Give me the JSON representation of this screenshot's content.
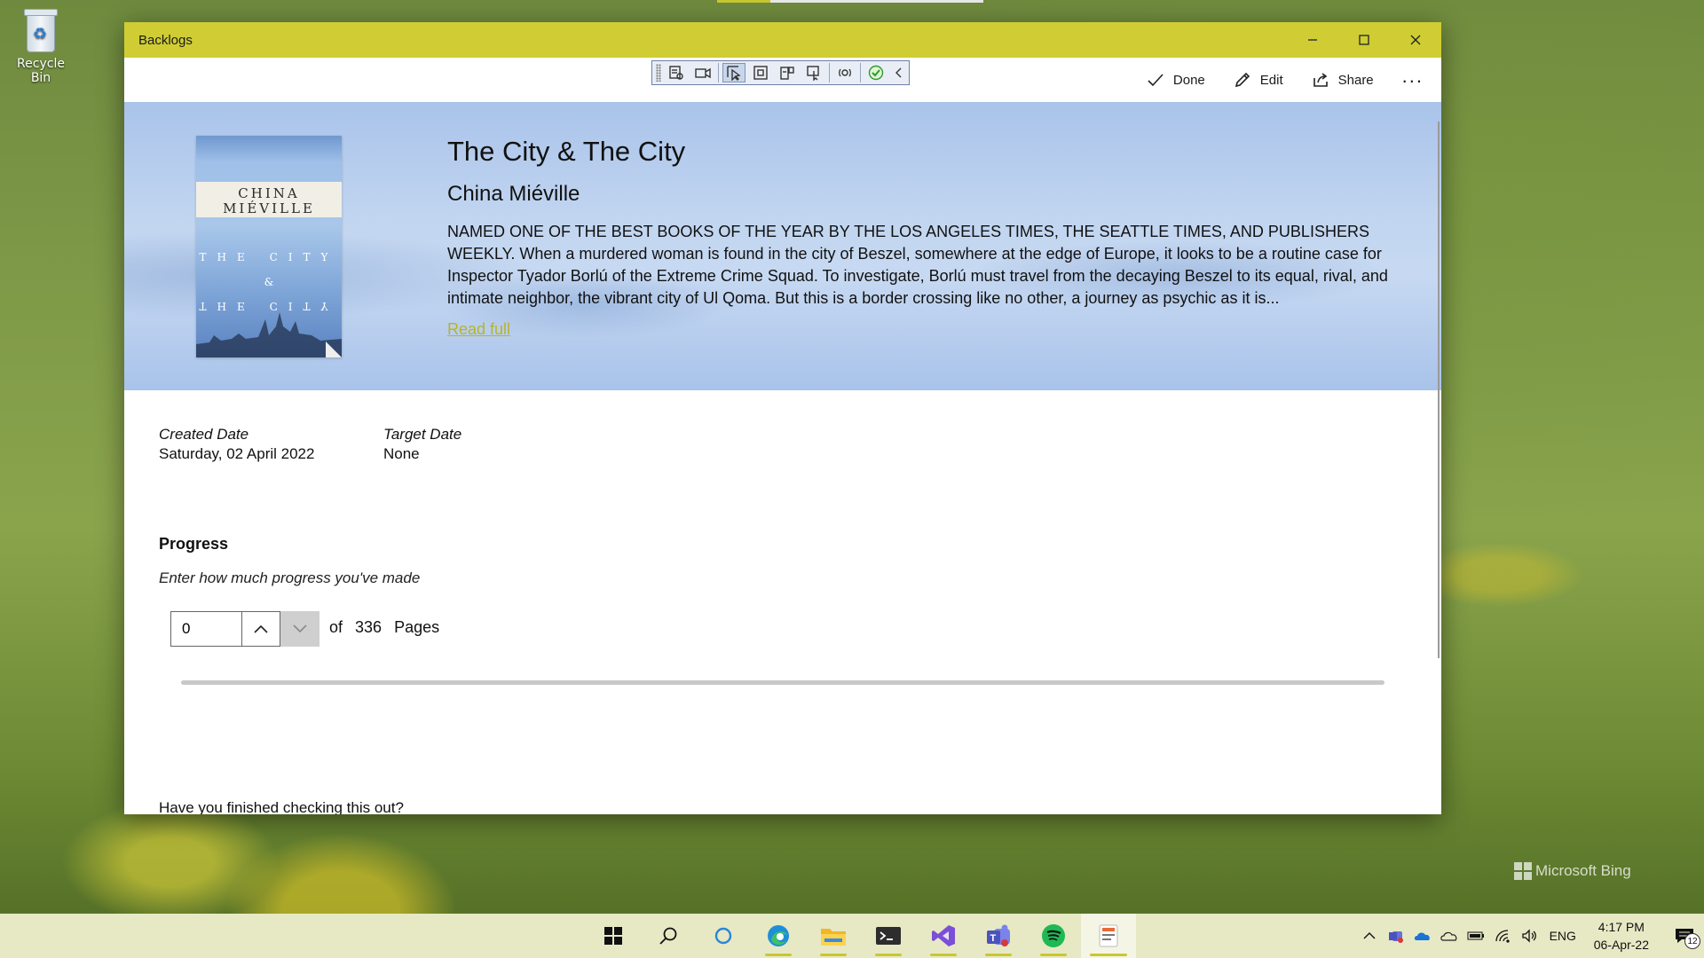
{
  "desktop": {
    "recycle_bin_label": "Recycle Bin",
    "watermark": "Microsoft Bing"
  },
  "window": {
    "title": "Backlogs",
    "controls": [
      "minimize",
      "maximize",
      "close"
    ]
  },
  "commands": {
    "done_label": "Done",
    "edit_label": "Edit",
    "share_label": "Share",
    "more_label": "..."
  },
  "debug_toolbar": {
    "tools": [
      "live-visual-tree-icon",
      "record-icon",
      "select-element-icon",
      "display-layout-adorners-icon",
      "track-focus-icon",
      "binding-failures-icon",
      "hot-reload-icon",
      "hot-reload-ok-icon",
      "collapse-icon"
    ]
  },
  "book": {
    "title": "The City & The City",
    "author": "China Miéville",
    "cover": {
      "author_line1": "CHINA",
      "author_line2": "MIÉVILLE",
      "title_line1": "THE CITY",
      "amp": "&",
      "title_line3": "THE CITY"
    },
    "description": "NAMED ONE OF THE BEST BOOKS OF THE YEAR BY THE LOS ANGELES TIMES, THE SEATTLE TIMES, AND PUBLISHERS WEEKLY. When a murdered woman is found in the city of Beszel, somewhere at the edge of Europe, it looks to be a routine case for Inspector Tyador Borlú of the Extreme Crime Squad. To investigate, Borlú must travel from the decaying Beszel to its equal, rival, and intimate neighbor, the vibrant city of Ul Qoma. But this is a border crossing like no other, a journey as psychic as it is...",
    "read_full_label": "Read full"
  },
  "details": {
    "created_label": "Created Date",
    "created_value": "Saturday, 02 April 2022",
    "target_label": "Target Date",
    "target_value": "None"
  },
  "progress": {
    "heading": "Progress",
    "prompt": "Enter how much progress you've made",
    "current_value": "0",
    "of_label": "of",
    "total": "336",
    "unit_label": "Pages",
    "fraction": 0
  },
  "finished_prompt": "Have you finished checking this out?",
  "colors": {
    "accent": "#cfcd33",
    "link": "#b8b427"
  },
  "taskbar": {
    "apps": [
      "windows-start-icon",
      "search-icon",
      "cortana-icon",
      "edge-icon",
      "file-explorer-icon",
      "terminal-icon",
      "visual-studio-icon",
      "teams-icon",
      "spotify-icon",
      "backlogs-app-icon"
    ],
    "tray_language": "ENG",
    "time": "4:17 PM",
    "date": "06-Apr-22",
    "notification_count": "12"
  }
}
